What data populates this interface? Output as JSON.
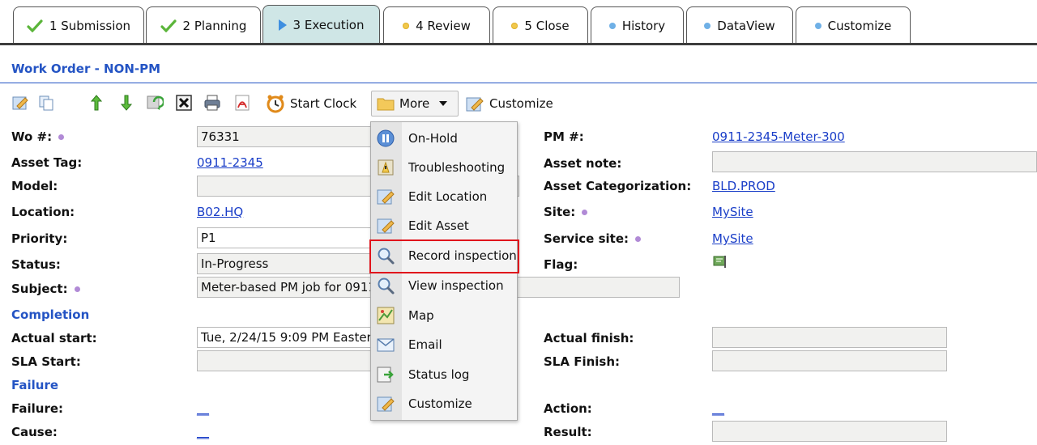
{
  "tabs": [
    {
      "label": "1 Submission",
      "marker": "check-icon"
    },
    {
      "label": "2 Planning",
      "marker": "check-icon"
    },
    {
      "label": "3 Execution",
      "marker": "play-icon",
      "active": true
    },
    {
      "label": "4 Review",
      "marker": "yellow-dot"
    },
    {
      "label": "5 Close",
      "marker": "yellow-dot"
    },
    {
      "label": "History",
      "marker": "blue-dot"
    },
    {
      "label": "DataView",
      "marker": "blue-dot"
    },
    {
      "label": "Customize",
      "marker": "blue-dot"
    }
  ],
  "page_title": "Work Order - NON-PM",
  "toolbar": {
    "start_clock": "Start Clock",
    "more": "More",
    "customize": "Customize"
  },
  "menu": {
    "items": [
      "On-Hold",
      "Troubleshooting",
      "Edit Location",
      "Edit Asset",
      "Record inspection",
      "View inspection",
      "Map",
      "Email",
      "Status log",
      "Customize"
    ],
    "highlighted": "Record inspection"
  },
  "form": {
    "wo_label": "Wo #:",
    "wo_value": "76331",
    "asset_tag_label": "Asset Tag:",
    "asset_tag_value": "0911-2345",
    "model_label": "Model:",
    "location_label": "Location:",
    "location_value": "B02.HQ",
    "priority_label": "Priority:",
    "priority_value": "P1",
    "status_label": "Status:",
    "status_value": "In-Progress",
    "subject_label": "Subject:",
    "subject_value": "Meter-based PM job for 0911",
    "completion": "Completion",
    "actual_start_label": "Actual start:",
    "actual_start_value": "Tue, 2/24/15 9:09 PM Eastern",
    "sla_start_label": "SLA Start:",
    "failure_section": "Failure",
    "failure_label": "Failure:",
    "cause_label": "Cause:",
    "pm_label": "PM #:",
    "pm_value": "0911-2345-Meter-300",
    "asset_note_label": "Asset note:",
    "asset_cat_label": "Asset Categorization:",
    "asset_cat_value": "BLD.PROD",
    "site_label": "Site:",
    "site_value": "MySite",
    "service_site_label": "Service site:",
    "service_site_value": "MySite",
    "flag_label": "Flag:",
    "actual_finish_label": "Actual finish:",
    "sla_finish_label": "SLA Finish:",
    "action_label": "Action:",
    "result_label": "Result:",
    "blank_link": "__"
  }
}
